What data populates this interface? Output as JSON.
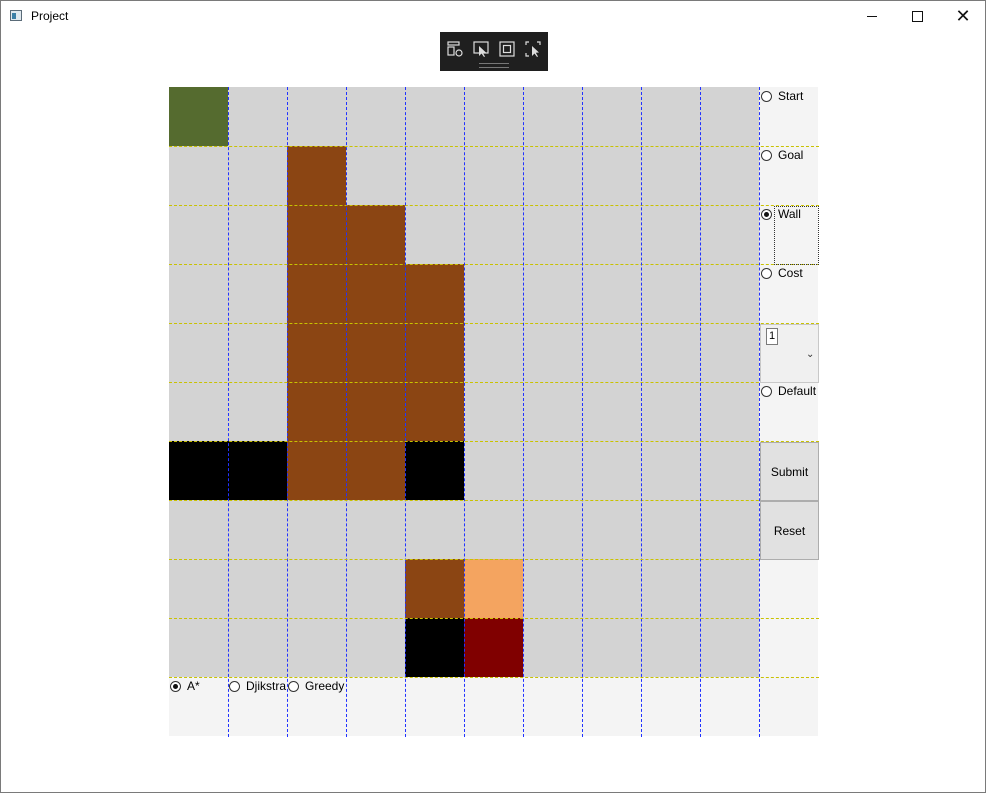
{
  "window": {
    "title": "Project"
  },
  "colors": {
    "empty": "#d3d3d3",
    "panel": "#f4f4f4",
    "start": "#556b2f",
    "wall": "#000000",
    "cost_brown": "#8b4513",
    "cost_orange": "#f4a460",
    "goal_red": "#800000"
  },
  "grid": {
    "rows": 10,
    "cols": 10,
    "cells": [
      [
        "start",
        "empty",
        "empty",
        "empty",
        "empty",
        "empty",
        "empty",
        "empty",
        "empty",
        "empty"
      ],
      [
        "empty",
        "empty",
        "cost_brown",
        "empty",
        "empty",
        "empty",
        "empty",
        "empty",
        "empty",
        "empty"
      ],
      [
        "empty",
        "empty",
        "cost_brown",
        "cost_brown",
        "empty",
        "empty",
        "empty",
        "empty",
        "empty",
        "empty"
      ],
      [
        "empty",
        "empty",
        "cost_brown",
        "cost_brown",
        "cost_brown",
        "empty",
        "empty",
        "empty",
        "empty",
        "empty"
      ],
      [
        "empty",
        "empty",
        "cost_brown",
        "cost_brown",
        "cost_brown",
        "empty",
        "empty",
        "empty",
        "empty",
        "empty"
      ],
      [
        "empty",
        "empty",
        "cost_brown",
        "cost_brown",
        "cost_brown",
        "empty",
        "empty",
        "empty",
        "empty",
        "empty"
      ],
      [
        "wall",
        "wall",
        "cost_brown",
        "cost_brown",
        "wall",
        "empty",
        "empty",
        "empty",
        "empty",
        "empty"
      ],
      [
        "empty",
        "empty",
        "empty",
        "empty",
        "empty",
        "empty",
        "empty",
        "empty",
        "empty",
        "empty"
      ],
      [
        "empty",
        "empty",
        "empty",
        "empty",
        "cost_brown",
        "cost_orange",
        "empty",
        "empty",
        "empty",
        "empty"
      ],
      [
        "empty",
        "empty",
        "empty",
        "empty",
        "wall",
        "goal_red",
        "empty",
        "empty",
        "empty",
        "empty"
      ]
    ]
  },
  "tools": {
    "start_label": "Start",
    "goal_label": "Goal",
    "wall_label": "Wall",
    "cost_label": "Cost",
    "cost_value": "1",
    "default_label": "Default",
    "selected": "wall"
  },
  "actions": {
    "submit_label": "Submit",
    "reset_label": "Reset"
  },
  "algorithms": {
    "astar_label": "A*",
    "dijkstra_label": "Djikstra",
    "greedy_label": "Greedy",
    "selected": "astar"
  }
}
